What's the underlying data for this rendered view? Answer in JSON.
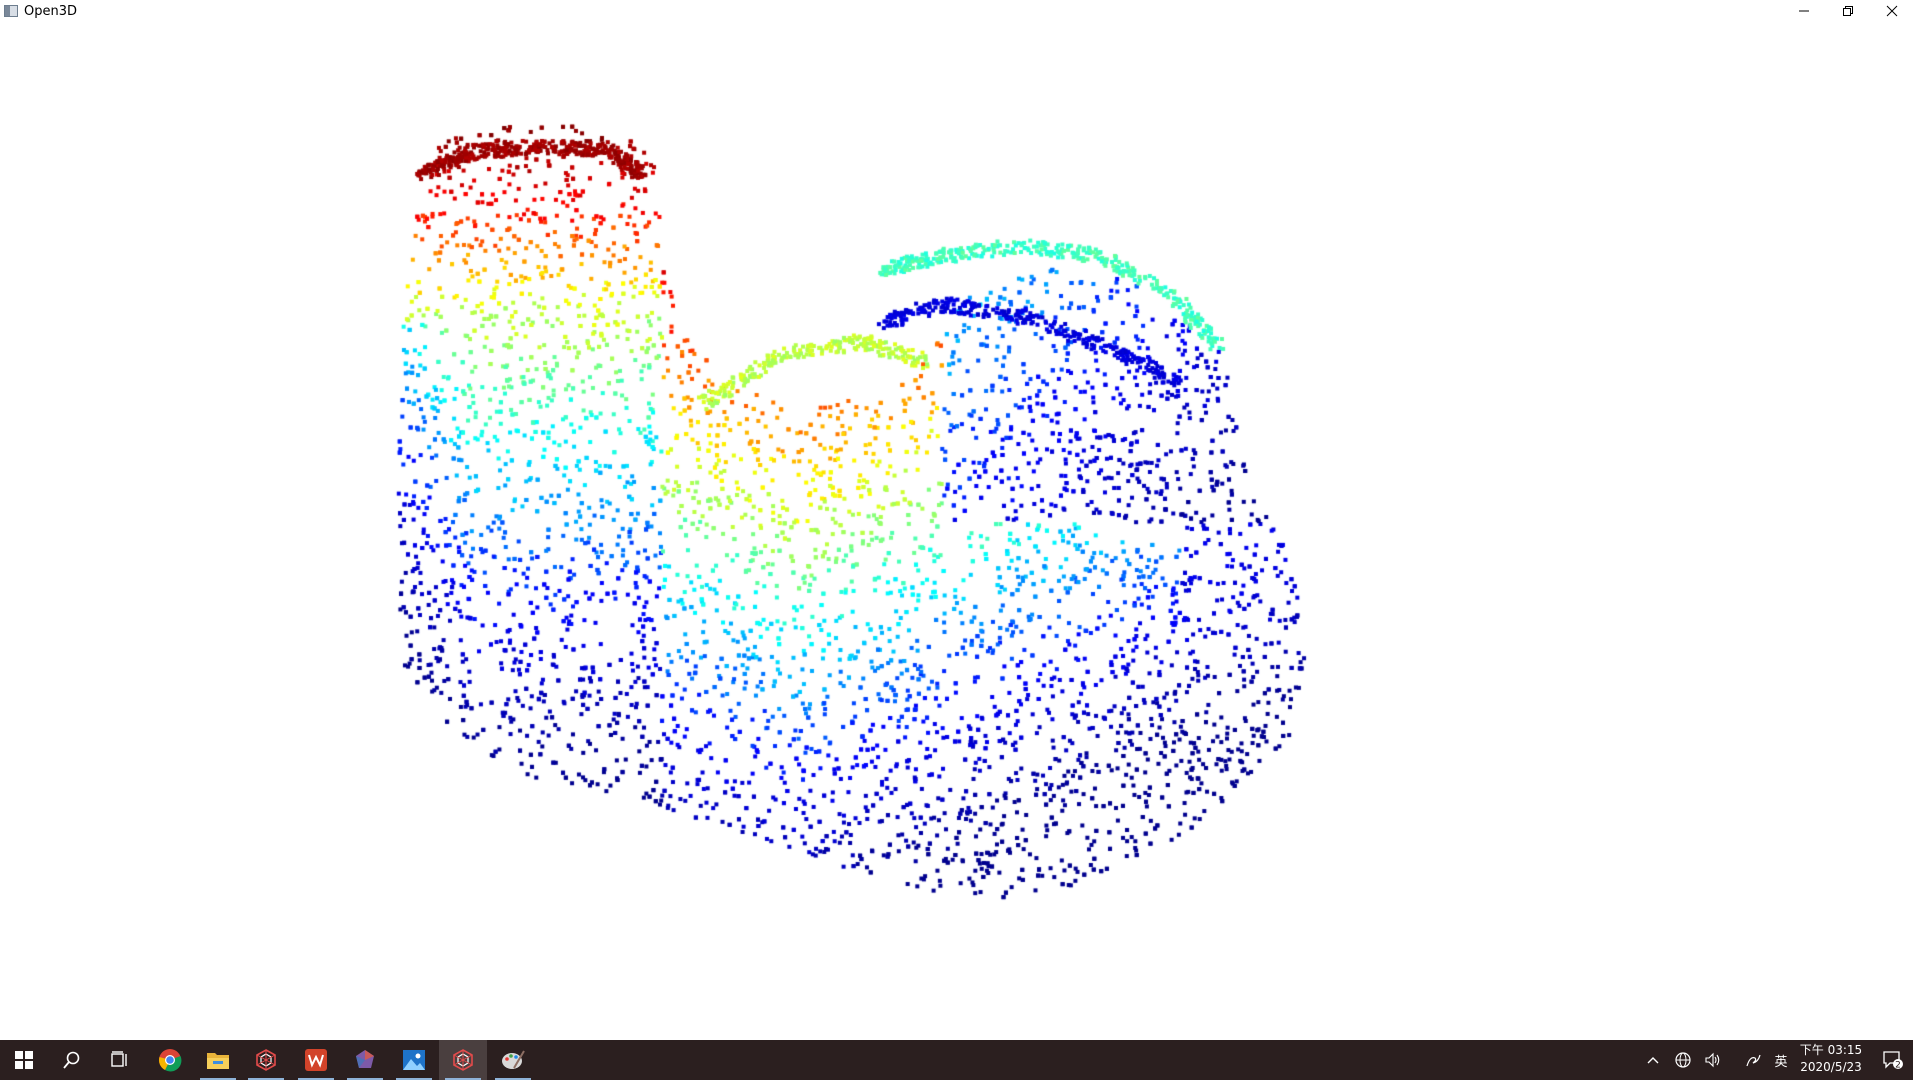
{
  "window": {
    "title": "Open3D"
  },
  "window_controls": {
    "minimize_icon": "minimize-icon",
    "restore_icon": "restore-icon",
    "close_icon": "close-icon"
  },
  "point_cloud": {
    "colormap": "jet",
    "color_stops": [
      "#00008f",
      "#0000ff",
      "#00ffff",
      "#ffff00",
      "#ff0000",
      "#800000"
    ],
    "background": "#ffffff"
  },
  "taskbar": {
    "background": "#2b1f1f",
    "apps": [
      {
        "icon": "windows-start-icon"
      },
      {
        "icon": "search-icon"
      },
      {
        "icon": "task-view-icon"
      },
      {
        "icon": "chrome-icon"
      },
      {
        "icon": "file-explorer-icon"
      },
      {
        "icon": "open3d-app-icon"
      },
      {
        "icon": "wps-writer-icon"
      },
      {
        "icon": "gem-app-icon"
      },
      {
        "icon": "photos-icon"
      },
      {
        "icon": "open3d-app-icon"
      },
      {
        "icon": "paint-icon"
      }
    ],
    "tray": {
      "show_hidden_icon": "chevron-up-icon",
      "network_icon": "globe-icon",
      "volume_icon": "speaker-icon",
      "pen_icon": "pen-icon",
      "ime_label": "英"
    },
    "clock": {
      "time": "下午 03:15",
      "date": "2020/5/23"
    },
    "notification_count": "2"
  }
}
